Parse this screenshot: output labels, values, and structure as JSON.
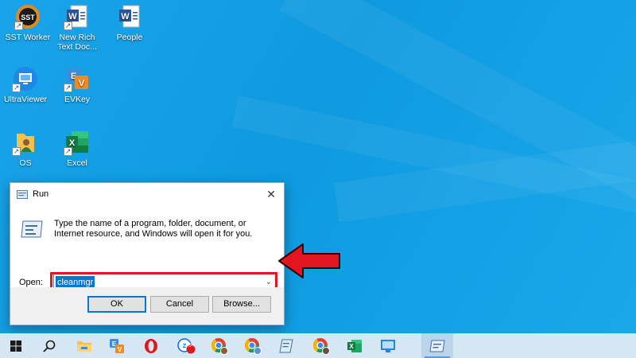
{
  "desktop": {
    "icons": [
      {
        "label": "SST Worker",
        "icon": "sst-worker-icon"
      },
      {
        "label": "New Rich Text Doc...",
        "icon": "word-document-icon"
      },
      {
        "label": "People",
        "icon": "word-document-icon"
      },
      {
        "label": "UltraViewer",
        "icon": "ultraviewer-icon"
      },
      {
        "label": "EVKey",
        "icon": "evkey-icon"
      },
      {
        "label": "OS",
        "icon": "folder-person-icon"
      },
      {
        "label": "Excel",
        "icon": "excel-icon"
      }
    ]
  },
  "run_dialog": {
    "title": "Run",
    "description": "Type the name of a program, folder, document, or Internet resource, and Windows will open it for you.",
    "open_label": "Open:",
    "input_value": "cleanmgr",
    "buttons": {
      "ok": "OK",
      "cancel": "Cancel",
      "browse": "Browse..."
    }
  },
  "taskbar": {
    "items": [
      "start-icon",
      "search-icon",
      "file-explorer-icon",
      "evkey-icon",
      "opera-icon",
      "zalo-icon",
      "chrome-profile-icon",
      "chrome-icon",
      "notepad-icon",
      "chrome-profile-icon",
      "excel-icon",
      "ultraviewer-icon",
      "run-icon"
    ],
    "zalo_badge": "5+"
  },
  "colors": {
    "accent": "#0078d7",
    "highlight_red": "#e11620",
    "desktop_blue": "#1aa3e8",
    "taskbar": "#d6e6f3"
  }
}
